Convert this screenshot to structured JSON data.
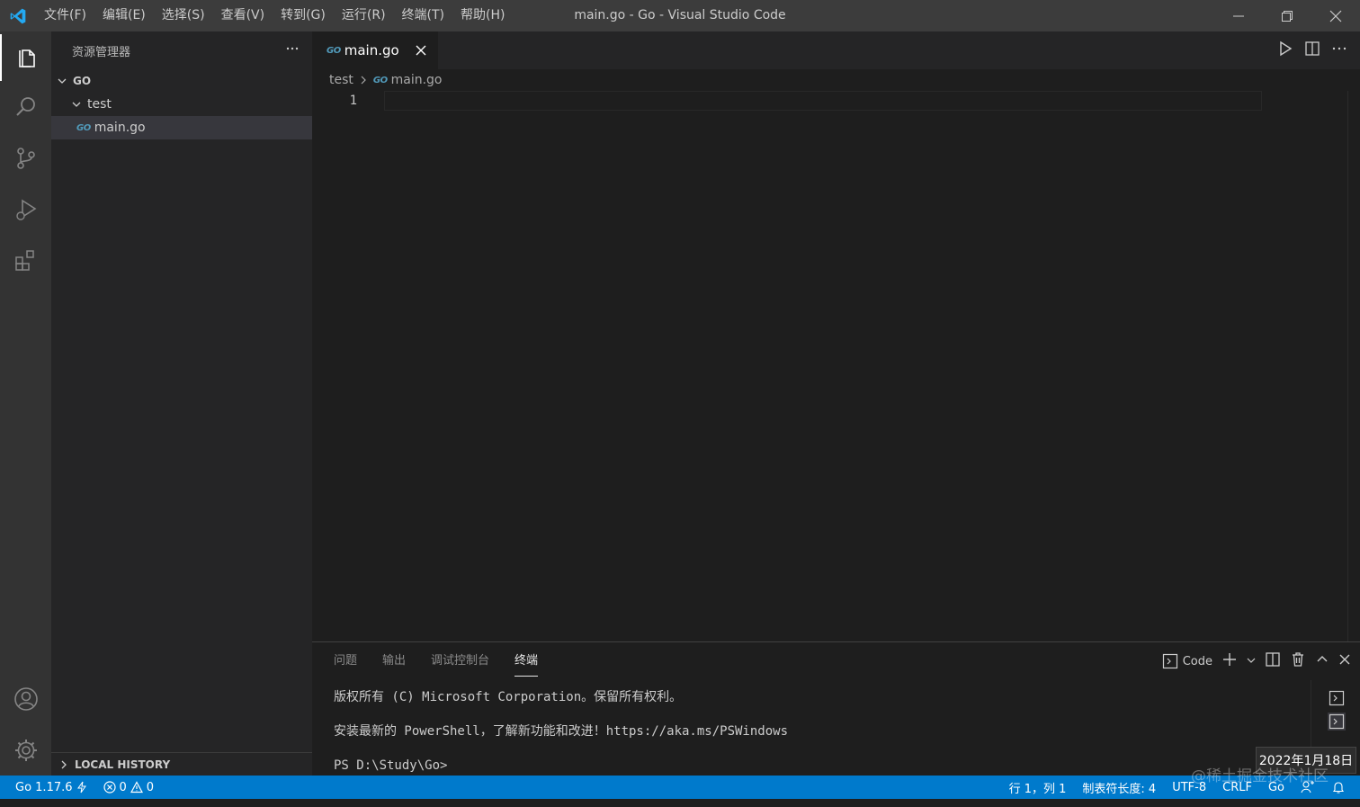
{
  "titlebar": {
    "menu": [
      "文件(F)",
      "编辑(E)",
      "选择(S)",
      "查看(V)",
      "转到(G)",
      "运行(R)",
      "终端(T)",
      "帮助(H)"
    ],
    "window_title": "main.go - Go - Visual Studio Code"
  },
  "sidebar": {
    "title": "资源管理器",
    "root": "GO",
    "folder": "test",
    "file": "main.go",
    "go_badge": "GO",
    "local_history": "LOCAL HISTORY"
  },
  "editor": {
    "tab_label": "main.go",
    "breadcrumb_folder": "test",
    "breadcrumb_file": "main.go",
    "line_number": "1"
  },
  "panel": {
    "tabs": [
      "问题",
      "输出",
      "调试控制台",
      "终端"
    ],
    "active_tab": "终端",
    "terminal_name": "Code",
    "terminal_lines": [
      "版权所有 (C) Microsoft Corporation。保留所有权利。",
      "安装最新的 PowerShell，了解新功能和改进！https://aka.ms/PSWindows",
      "PS D:\\Study\\Go>"
    ]
  },
  "statusbar": {
    "go_version": "Go 1.17.6",
    "errors": "0",
    "warnings": "0",
    "position": "行 1，列 1",
    "indent": "制表符长度: 4",
    "encoding": "UTF-8",
    "eol": "CRLF",
    "language": "Go"
  },
  "overlay": {
    "date": "2022年1月18日",
    "watermark": "@稀土掘金技术社区"
  },
  "colors": {
    "accent": "#007acc",
    "titlebar": "#3c3c3c",
    "activitybar": "#333333",
    "sidebar": "#252526",
    "editor": "#1e1e1e",
    "go_icon": "#519aba",
    "vscode_logo": "#23a9f2"
  }
}
